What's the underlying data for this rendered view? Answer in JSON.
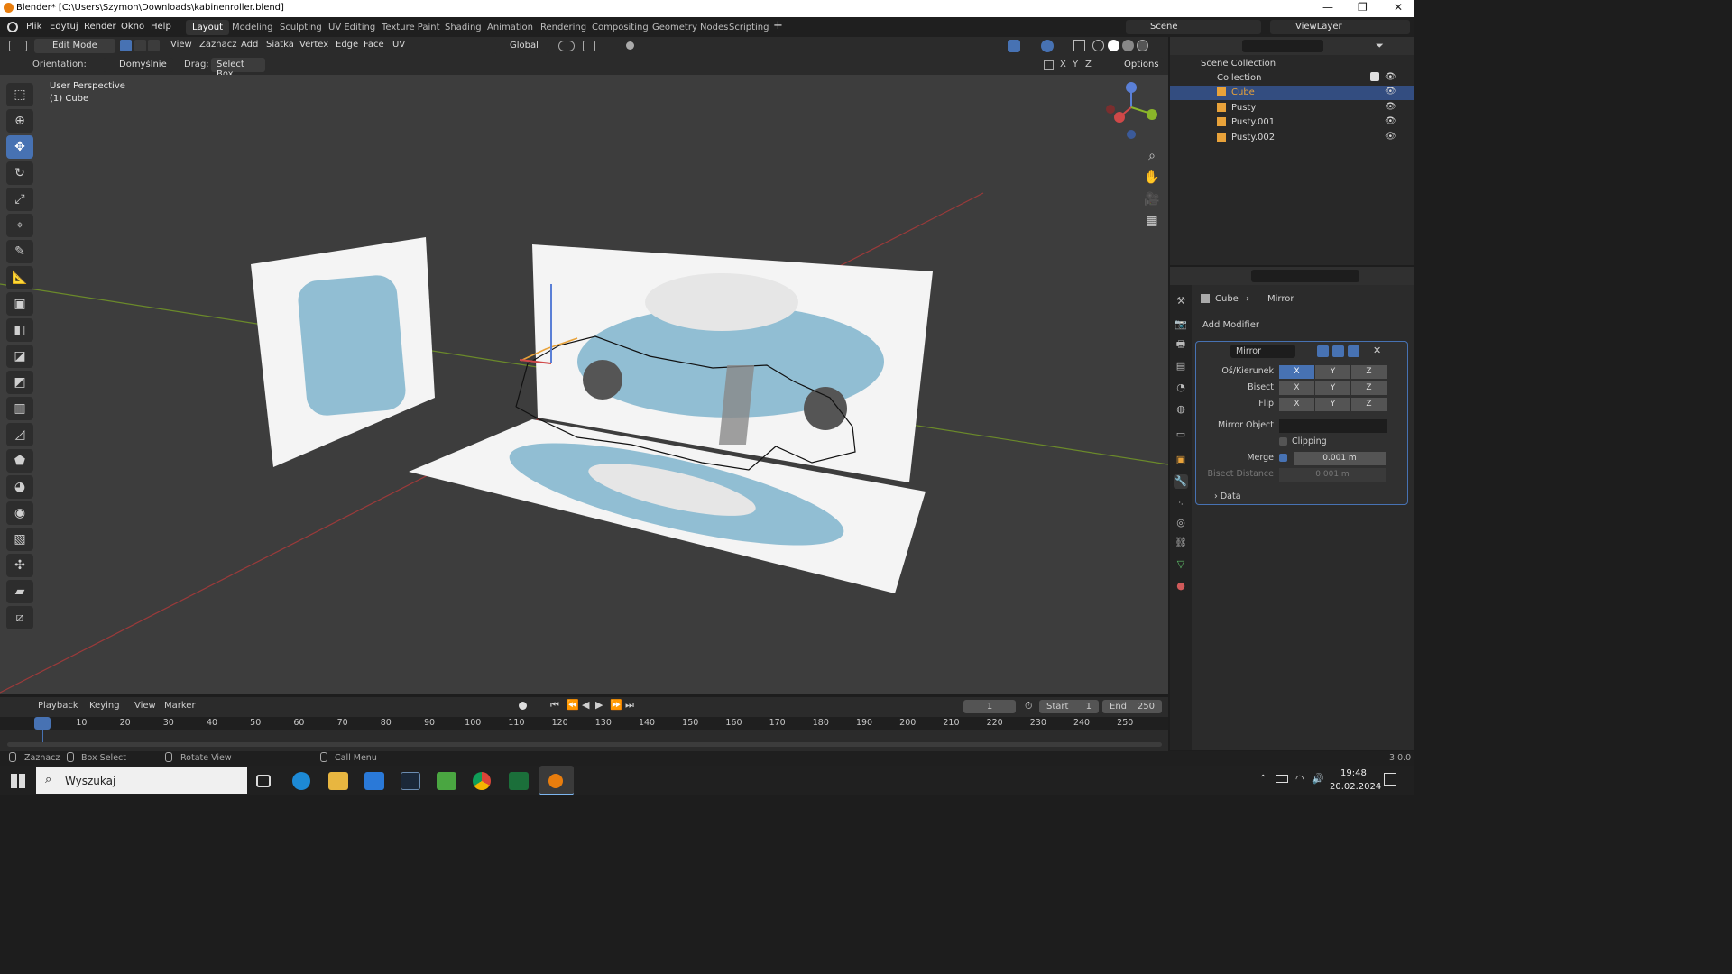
{
  "window": {
    "title": "Blender* [C:\\Users\\Szymon\\Downloads\\kabinenroller.blend]"
  },
  "menu": [
    "Plik",
    "Edytuj",
    "Render",
    "Okno",
    "Help"
  ],
  "workspaces": [
    "Layout",
    "Modeling",
    "Sculpting",
    "UV Editing",
    "Texture Paint",
    "Shading",
    "Animation",
    "Rendering",
    "Compositing",
    "Geometry Nodes",
    "Scripting"
  ],
  "scene": {
    "label": "Scene",
    "viewlayer": "ViewLayer"
  },
  "header": {
    "mode": "Edit Mode",
    "menus": [
      "View",
      "Zaznacz",
      "Add",
      "Siatka",
      "Vertex",
      "Edge",
      "Face",
      "UV"
    ],
    "transform": "Global",
    "orientation_label": "Orientation:",
    "orientation_value": "Domyślnie",
    "drag_label": "Drag:",
    "drag_value": "Select Box",
    "axes": [
      "X",
      "Y",
      "Z"
    ],
    "options": "Options"
  },
  "viewport": {
    "perspective": "User Perspective",
    "object": "(1) Cube"
  },
  "outliner": {
    "scene_collection": "Scene Collection",
    "collection": "Collection",
    "items": [
      "Cube",
      "Pusty",
      "Pusty.001",
      "Pusty.002"
    ]
  },
  "properties": {
    "breadcrumb_object": "Cube",
    "breadcrumb_modifier": "Mirror",
    "add_modifier": "Add Modifier",
    "modifier_name": "Mirror",
    "axis_label": "Oś/Kierunek",
    "bisect_label": "Bisect",
    "flip_label": "Flip",
    "mirror_object_label": "Mirror Object",
    "clipping_label": "Clipping",
    "merge_label": "Merge",
    "merge_value": "0.001 m",
    "bisect_distance_label": "Bisect Distance",
    "bisect_distance_value": "0.001 m",
    "data_label": "Data",
    "xyz": [
      "X",
      "Y",
      "Z"
    ]
  },
  "timeline": {
    "menus": [
      "Playback",
      "Keying",
      "View",
      "Marker"
    ],
    "current_frame": "1",
    "start_label": "Start",
    "start": "1",
    "end_label": "End",
    "end": "250",
    "ticks": [
      "1",
      "10",
      "20",
      "30",
      "40",
      "50",
      "60",
      "70",
      "80",
      "90",
      "100",
      "110",
      "120",
      "130",
      "140",
      "150",
      "160",
      "170",
      "180",
      "190",
      "200",
      "210",
      "220",
      "230",
      "240",
      "250"
    ]
  },
  "statusbar": {
    "select": "Zaznacz",
    "box_select": "Box Select",
    "rotate": "Rotate View",
    "call_menu": "Call Menu",
    "version": "3.0.0"
  },
  "taskbar": {
    "search_placeholder": "Wyszukaj",
    "time": "19:48",
    "date": "20.02.2024"
  },
  "colors": {
    "accent": "#4772b3",
    "viewport_bg": "#3d3d3d",
    "panel_bg": "#2b2b2b",
    "selection_orange": "#e8a23a"
  }
}
